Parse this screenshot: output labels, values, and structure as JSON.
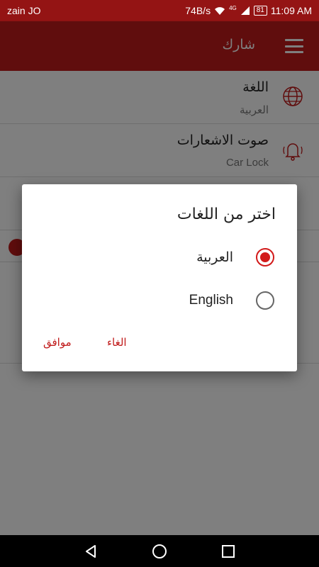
{
  "status_bar": {
    "carrier": "zain JO",
    "speed": "74B/s",
    "network": "4G",
    "battery": "81",
    "time": "11:09 AM"
  },
  "app_bar": {
    "title": "شارك",
    "menu_icon": "hamburger-menu-icon"
  },
  "settings": [
    {
      "title": "اللغة",
      "subtitle": "العربية",
      "icon": "globe-icon"
    },
    {
      "title": "صوت الاشعارات",
      "subtitle": "Car Lock",
      "icon": "bell-icon"
    }
  ],
  "dialog": {
    "title": "اختر من اللغات",
    "options": [
      {
        "label": "العربية",
        "selected": true
      },
      {
        "label": "English",
        "selected": false
      }
    ],
    "cancel_label": "الغاء",
    "ok_label": "موافق"
  },
  "colors": {
    "accent": "#c01a1a",
    "status_bar": "#941414"
  },
  "nav_bar": {
    "back_icon": "back-triangle-icon",
    "home_icon": "home-circle-icon",
    "recents_icon": "recents-square-icon"
  }
}
